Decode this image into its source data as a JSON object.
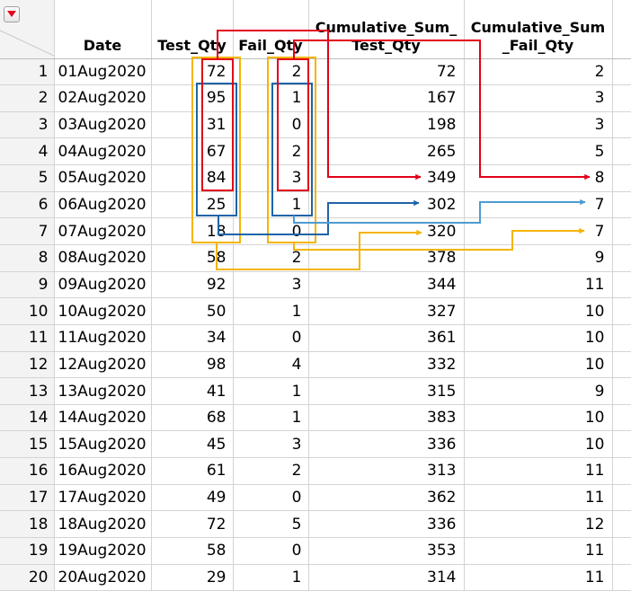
{
  "colors": {
    "red": "#e2001a",
    "blue": "#1f64a8",
    "light_blue": "#4d9bd2",
    "yellow": "#f4b400",
    "grid_line": "#d4d4d4",
    "row_number_bg": "#f3f3f3"
  },
  "icons": {
    "column_menu": "red-down-triangle-icon"
  },
  "table": {
    "columns": [
      "Date",
      "Test_Qty",
      "Fail_Qty",
      "Cumulative_Sum_\nTest_Qty",
      "Cumulative_Sum\n_Fail_Qty"
    ],
    "rows": [
      {
        "n": "1",
        "date": "01Aug2020",
        "test": "72",
        "fail": "2",
        "cum_test": "72",
        "cum_fail": "2"
      },
      {
        "n": "2",
        "date": "02Aug2020",
        "test": "95",
        "fail": "1",
        "cum_test": "167",
        "cum_fail": "3"
      },
      {
        "n": "3",
        "date": "03Aug2020",
        "test": "31",
        "fail": "0",
        "cum_test": "198",
        "cum_fail": "3"
      },
      {
        "n": "4",
        "date": "04Aug2020",
        "test": "67",
        "fail": "2",
        "cum_test": "265",
        "cum_fail": "5"
      },
      {
        "n": "5",
        "date": "05Aug2020",
        "test": "84",
        "fail": "3",
        "cum_test": "349",
        "cum_fail": "8"
      },
      {
        "n": "6",
        "date": "06Aug2020",
        "test": "25",
        "fail": "1",
        "cum_test": "302",
        "cum_fail": "7"
      },
      {
        "n": "7",
        "date": "07Aug2020",
        "test": "18",
        "fail": "0",
        "cum_test": "320",
        "cum_fail": "7"
      },
      {
        "n": "8",
        "date": "08Aug2020",
        "test": "58",
        "fail": "2",
        "cum_test": "378",
        "cum_fail": "9"
      },
      {
        "n": "9",
        "date": "09Aug2020",
        "test": "92",
        "fail": "3",
        "cum_test": "344",
        "cum_fail": "11"
      },
      {
        "n": "10",
        "date": "10Aug2020",
        "test": "50",
        "fail": "1",
        "cum_test": "327",
        "cum_fail": "10"
      },
      {
        "n": "11",
        "date": "11Aug2020",
        "test": "34",
        "fail": "0",
        "cum_test": "361",
        "cum_fail": "10"
      },
      {
        "n": "12",
        "date": "12Aug2020",
        "test": "98",
        "fail": "4",
        "cum_test": "332",
        "cum_fail": "10"
      },
      {
        "n": "13",
        "date": "13Aug2020",
        "test": "41",
        "fail": "1",
        "cum_test": "315",
        "cum_fail": "9"
      },
      {
        "n": "14",
        "date": "14Aug2020",
        "test": "68",
        "fail": "1",
        "cum_test": "383",
        "cum_fail": "10"
      },
      {
        "n": "15",
        "date": "15Aug2020",
        "test": "45",
        "fail": "3",
        "cum_test": "336",
        "cum_fail": "10"
      },
      {
        "n": "16",
        "date": "16Aug2020",
        "test": "61",
        "fail": "2",
        "cum_test": "313",
        "cum_fail": "11"
      },
      {
        "n": "17",
        "date": "17Aug2020",
        "test": "49",
        "fail": "0",
        "cum_test": "362",
        "cum_fail": "11"
      },
      {
        "n": "18",
        "date": "18Aug2020",
        "test": "72",
        "fail": "5",
        "cum_test": "336",
        "cum_fail": "12"
      },
      {
        "n": "19",
        "date": "19Aug2020",
        "test": "58",
        "fail": "0",
        "cum_test": "353",
        "cum_fail": "11"
      },
      {
        "n": "20",
        "date": "20Aug2020",
        "test": "29",
        "fail": "1",
        "cum_test": "314",
        "cum_fail": "11"
      }
    ]
  }
}
